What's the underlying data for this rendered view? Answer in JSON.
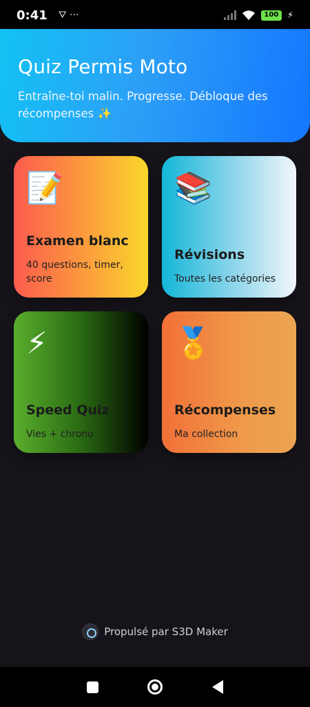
{
  "status_bar": {
    "time": "0:41",
    "notification_icons": "⛛ ···",
    "battery": "100",
    "charging_icon": "⚡"
  },
  "header": {
    "title": "Quiz Permis Moto",
    "subtitle": "Entraîne-toi malin. Progresse. Débloque des récompenses ✨"
  },
  "cards": {
    "exam": {
      "icon": "📝",
      "title": "Examen blanc",
      "desc": "40 questions, timer, score"
    },
    "revisions": {
      "icon": "📚",
      "title": "Révisions",
      "desc": "Toutes les catégories"
    },
    "speed": {
      "icon": "⚡",
      "title": "Speed Quiz",
      "desc": "Vies + chrono"
    },
    "rewards": {
      "icon": "🏅",
      "title": "Récompenses",
      "desc": "Ma collection"
    }
  },
  "footer": {
    "text": "Propulsé par S3D Maker"
  },
  "colors": {
    "header_start": "#12c2f4",
    "header_end": "#1476ff",
    "background": "#16141a"
  }
}
